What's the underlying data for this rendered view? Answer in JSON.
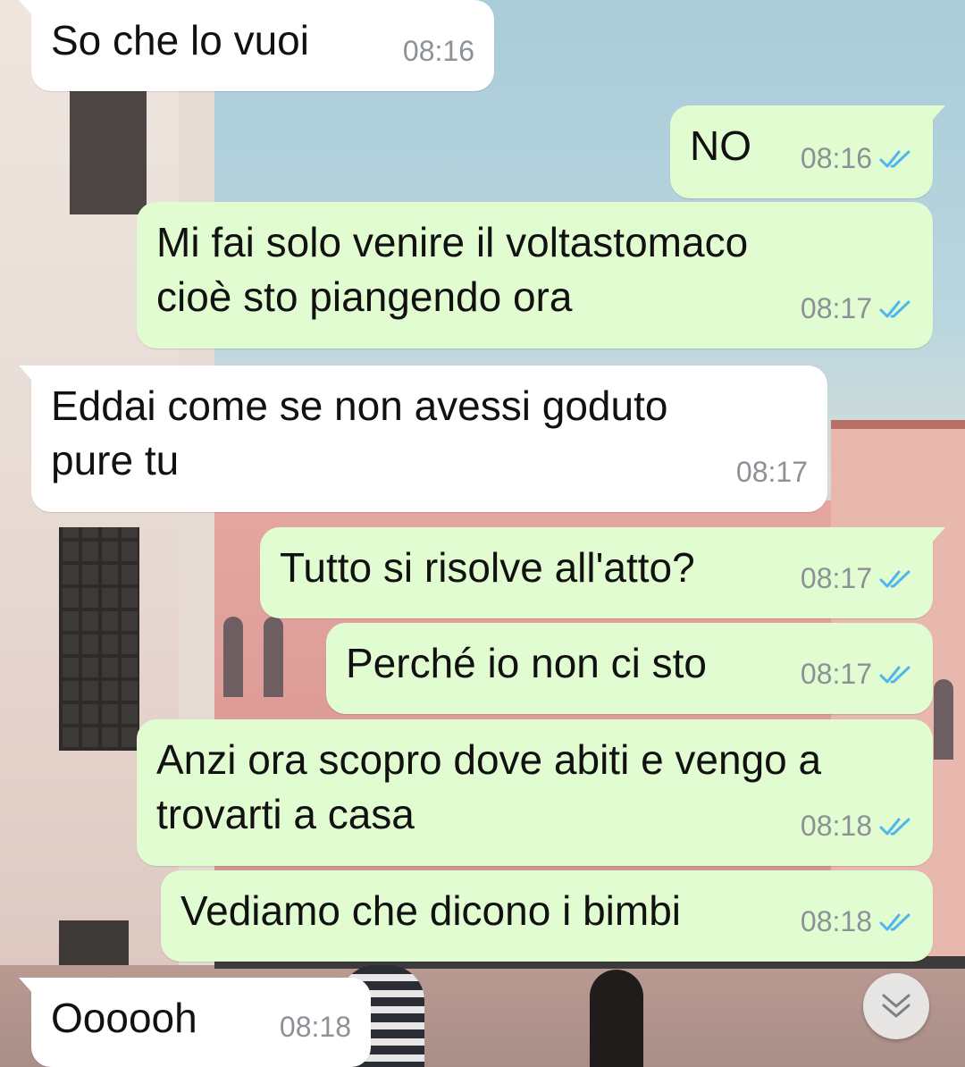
{
  "messages": [
    {
      "text": "So che lo vuoi",
      "time": "08:16",
      "direction": "in"
    },
    {
      "text": "NO",
      "time": "08:16",
      "direction": "out",
      "status": "read"
    },
    {
      "text": "Mi fai solo venire il voltastomaco\ncioè sto piangendo ora",
      "time": "08:17",
      "direction": "out",
      "status": "read"
    },
    {
      "text": "Eddai come se non avessi goduto\npure tu",
      "time": "08:17",
      "direction": "in"
    },
    {
      "text": "Tutto si risolve all'atto?",
      "time": "08:17",
      "direction": "out",
      "status": "read"
    },
    {
      "text": "Perché io non ci sto",
      "time": "08:17",
      "direction": "out",
      "status": "read"
    },
    {
      "text": "Anzi ora scopro dove abiti e vengo a\ntrovarti a casa",
      "time": "08:18",
      "direction": "out",
      "status": "read"
    },
    {
      "text": "Vediamo che dicono i bimbi",
      "time": "08:18",
      "direction": "out",
      "status": "read"
    },
    {
      "text": "Oooooh",
      "time": "08:18",
      "direction": "in"
    }
  ],
  "colors": {
    "incoming_bubble": "#ffffff",
    "outgoing_bubble": "#e2fcd1",
    "read_tick": "#4fb6ec",
    "timestamp": "#8b9196"
  },
  "icons": {
    "read_receipt": "double-check-icon",
    "scroll_button": "double-chevron-down-icon"
  }
}
